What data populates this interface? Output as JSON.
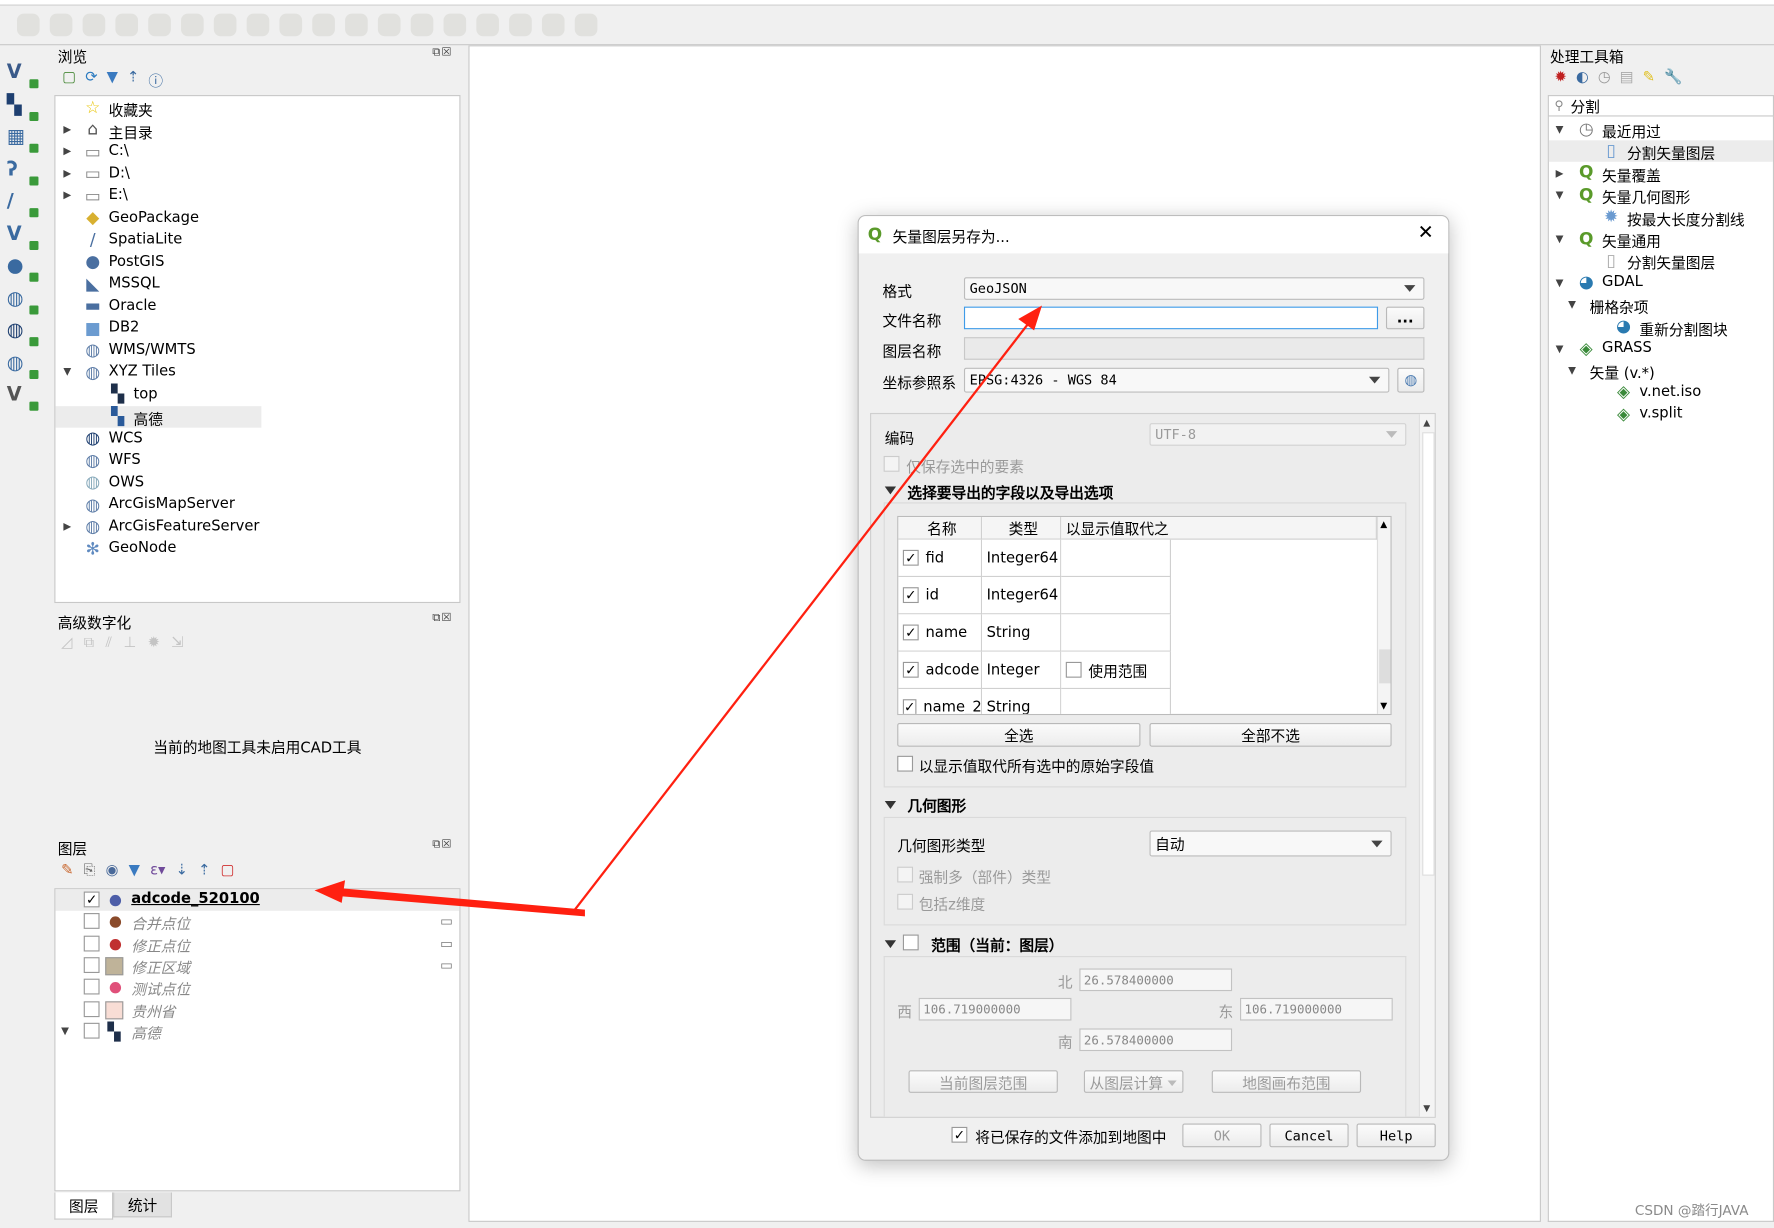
{
  "toolbar": {
    "icons": [
      "digitize-icon",
      "points-icon",
      "polygon-ring-icon",
      "polygon-fill-icon",
      "add-ring-icon",
      "add-part-icon",
      "fill-ring-icon",
      "delete-ring-icon",
      "delete-part-icon",
      "reshape-icon",
      "offset-icon",
      "vertex-icon",
      "split-icon",
      "split-features-icon",
      "split-parts-icon",
      "merge-icon",
      "merge-attr-icon",
      "rotate-icon"
    ]
  },
  "left_toolbar": {
    "icons": [
      "add-vector-layer-icon",
      "add-raster-layer-icon",
      "add-mesh-layer-icon",
      "add-delimited-text-icon",
      "add-spatialite-icon",
      "add-virtual-layer-icon",
      "add-postgis-icon",
      "add-wms-icon",
      "add-wcs-icon",
      "add-wfs-icon",
      "new-layer-icon"
    ]
  },
  "browser": {
    "title": "浏览",
    "items": [
      {
        "label": "收藏夹",
        "icon": "star-icon",
        "glyph": "☆",
        "color": "#e8c400",
        "expand": "",
        "depth": 0
      },
      {
        "label": "主目录",
        "icon": "home-folder-icon",
        "glyph": "⌂",
        "color": "#555",
        "expand": "▶",
        "depth": 0
      },
      {
        "label": "C:\\",
        "icon": "folder-icon",
        "glyph": "▭",
        "color": "#888",
        "expand": "▶",
        "depth": 0
      },
      {
        "label": "D:\\",
        "icon": "folder-icon",
        "glyph": "▭",
        "color": "#888",
        "expand": "▶",
        "depth": 0
      },
      {
        "label": "E:\\",
        "icon": "folder-icon",
        "glyph": "▭",
        "color": "#888",
        "expand": "▶",
        "depth": 0
      },
      {
        "label": "GeoPackage",
        "icon": "geopackage-icon",
        "glyph": "◆",
        "color": "#d8b030",
        "expand": "",
        "depth": 0
      },
      {
        "label": "SpatiaLite",
        "icon": "feather-icon",
        "glyph": "/",
        "color": "#4a6fa0",
        "expand": "",
        "depth": 0
      },
      {
        "label": "PostGIS",
        "icon": "elephant-icon",
        "glyph": "●",
        "color": "#4a6fa0",
        "expand": "",
        "depth": 0
      },
      {
        "label": "MSSQL",
        "icon": "mssql-icon",
        "glyph": "◣",
        "color": "#4a6fa0",
        "expand": "",
        "depth": 0
      },
      {
        "label": "Oracle",
        "icon": "oracle-icon",
        "glyph": "▬",
        "color": "#4a6fa0",
        "expand": "",
        "depth": 0
      },
      {
        "label": "DB2",
        "icon": "db2-icon",
        "glyph": "■",
        "color": "#6b9bd0",
        "expand": "",
        "depth": 0
      },
      {
        "label": "WMS/WMTS",
        "icon": "globe-icon",
        "glyph": "◍",
        "color": "#5f7ea8",
        "expand": "",
        "depth": 0
      },
      {
        "label": "XYZ Tiles",
        "icon": "globe-icon",
        "glyph": "◍",
        "color": "#5f7ea8",
        "expand": "▼",
        "depth": 0
      },
      {
        "label": "top",
        "icon": "tile-icon",
        "glyph": "▚",
        "color": "#1e2f4a",
        "expand": "",
        "depth": 1
      },
      {
        "label": "高德",
        "icon": "tile-icon",
        "glyph": "▚",
        "color": "#2a5a9a",
        "expand": "",
        "depth": 1,
        "selected": true
      },
      {
        "label": "WCS",
        "icon": "globe-icon",
        "glyph": "◍",
        "color": "#1e3f70",
        "expand": "",
        "depth": 0
      },
      {
        "label": "WFS",
        "icon": "globe-icon",
        "glyph": "◍",
        "color": "#5f7ea8",
        "expand": "",
        "depth": 0
      },
      {
        "label": "OWS",
        "icon": "globe-icon",
        "glyph": "◍",
        "color": "#8ab",
        "expand": "",
        "depth": 0
      },
      {
        "label": "ArcGisMapServer",
        "icon": "globe-icon",
        "glyph": "◍",
        "color": "#5f7ea8",
        "expand": "",
        "depth": 0
      },
      {
        "label": "ArcGisFeatureServer",
        "icon": "globe-icon",
        "glyph": "◍",
        "color": "#5f7ea8",
        "expand": "▶",
        "depth": 0
      },
      {
        "label": "GeoNode",
        "icon": "geonode-icon",
        "glyph": "✻",
        "color": "#5f8ac0",
        "expand": "",
        "depth": 0
      }
    ]
  },
  "advanced_digitizing": {
    "title": "高级数字化",
    "message": "当前的地图工具未启用CAD工具"
  },
  "layers": {
    "title": "图层",
    "items": [
      {
        "label": "adcode_520100",
        "checked": true,
        "symbol": "circle",
        "color": "#4d5ea8",
        "active": true,
        "expand": ""
      },
      {
        "label": "合并点位",
        "checked": false,
        "symbol": "circle",
        "color": "#8a4a2a",
        "memory": true,
        "expand": ""
      },
      {
        "label": "修正点位",
        "checked": false,
        "symbol": "circle",
        "color": "#c03030",
        "memory": true,
        "expand": ""
      },
      {
        "label": "修正区域",
        "checked": false,
        "symbol": "square",
        "color": "#bfb399",
        "memory": true,
        "expand": ""
      },
      {
        "label": "测试点位",
        "checked": false,
        "symbol": "circle",
        "color": "#e0507a",
        "expand": ""
      },
      {
        "label": "贵州省",
        "checked": false,
        "symbol": "square",
        "color": "#f8ddd5",
        "expand": ""
      },
      {
        "label": "高德",
        "checked": false,
        "symbol": "tile",
        "color": "#1e2f4a",
        "expand": "▼"
      }
    ],
    "tabs": [
      "图层",
      "统计"
    ]
  },
  "processing": {
    "title": "处理工具箱",
    "search": "分割",
    "items": [
      {
        "label": "最近用过",
        "depth": 0,
        "expand": "▼",
        "icon": "clock-icon",
        "glyph": "◷",
        "color": "#777"
      },
      {
        "label": "分割矢量图层",
        "depth": 1,
        "expand": "",
        "icon": "split-layer-icon",
        "glyph": "▯",
        "color": "#6a9ad0",
        "selected": true
      },
      {
        "label": "矢量覆盖",
        "depth": 0,
        "expand": "▶",
        "icon": "qgis-icon",
        "glyph": "Q",
        "color": "#5a9a2a"
      },
      {
        "label": "矢量几何图形",
        "depth": 0,
        "expand": "▼",
        "icon": "qgis-icon",
        "glyph": "Q",
        "color": "#5a9a2a"
      },
      {
        "label": "按最大长度分割线",
        "depth": 1,
        "expand": "",
        "icon": "gear-icon",
        "glyph": "✹",
        "color": "#6a9ad0"
      },
      {
        "label": "矢量通用",
        "depth": 0,
        "expand": "▼",
        "icon": "qgis-icon",
        "glyph": "Q",
        "color": "#5a9a2a"
      },
      {
        "label": "分割矢量图层",
        "depth": 1,
        "expand": "",
        "icon": "split-layer-icon",
        "glyph": "▯",
        "color": "#aaa"
      },
      {
        "label": "GDAL",
        "depth": 0,
        "expand": "▼",
        "icon": "gdal-icon",
        "glyph": "◕",
        "color": "#2a7ab0"
      },
      {
        "label": "栅格杂项",
        "depth": 0.5,
        "expand": "▼",
        "icon": "",
        "glyph": "",
        "color": ""
      },
      {
        "label": "重新分割图块",
        "depth": 1.5,
        "expand": "",
        "icon": "gdal-icon",
        "glyph": "◕",
        "color": "#2a7ab0"
      },
      {
        "label": "GRASS",
        "depth": 0,
        "expand": "▼",
        "icon": "grass-icon",
        "glyph": "◈",
        "color": "#3a8a3a"
      },
      {
        "label": "矢量 (v.*)",
        "depth": 0.5,
        "expand": "▼",
        "icon": "",
        "glyph": "",
        "color": ""
      },
      {
        "label": "v.net.iso",
        "depth": 1.5,
        "expand": "",
        "icon": "grass-icon",
        "glyph": "◈",
        "color": "#3a8a3a"
      },
      {
        "label": "v.split",
        "depth": 1.5,
        "expand": "",
        "icon": "grass-icon",
        "glyph": "◈",
        "color": "#3a8a3a"
      }
    ]
  },
  "dialog": {
    "title": "矢量图层另存为...",
    "format_label": "格式",
    "format_value": "GeoJSON",
    "filename_label": "文件名称",
    "filename_value": "",
    "browse_label": "...",
    "layername_label": "图层名称",
    "layername_value": "",
    "crs_label": "坐标参照系",
    "crs_value": "EPSG:4326 - WGS 84",
    "encoding_label": "编码",
    "encoding_value": "UTF-8",
    "selected_only_label": "仅保存选中的要素",
    "fields_header": "选择要导出的字段以及导出选项",
    "fields_columns": [
      "名称",
      "类型",
      "以显示值取代之"
    ],
    "fields": [
      {
        "name": "fid",
        "type": "Integer64",
        "checked": true,
        "replace": ""
      },
      {
        "name": "id",
        "type": "Integer64",
        "checked": true,
        "replace": ""
      },
      {
        "name": "name",
        "type": "String",
        "checked": true,
        "replace": ""
      },
      {
        "name": "adcode",
        "type": "Integer",
        "checked": true,
        "replace": "使用范围"
      },
      {
        "name": "name_2",
        "type": "String",
        "checked": true,
        "replace": ""
      }
    ],
    "select_all": "全选",
    "deselect_all": "全部不选",
    "replace_all_label": "以显示值取代所有选中的原始字段值",
    "geometry_header": "几何图形",
    "geometry_type_label": "几何图形类型",
    "geometry_type_value": "自动",
    "force_multi_label": "强制多（部件）类型",
    "include_z_label": "包括z维度",
    "extent_header": "范围（当前：图层）",
    "north_label": "北",
    "north": "26.578400000",
    "west_label": "西",
    "west": "106.719000000",
    "east_label": "东",
    "east": "106.719000000",
    "south_label": "南",
    "south": "26.578400000",
    "current_layer_extent": "当前图层范围",
    "calc_from_layer": "从图层计算",
    "map_canvas_extent": "地图画布范围",
    "add_to_map_label": "将已保存的文件添加到地图中",
    "ok": "OK",
    "cancel": "Cancel",
    "help": "Help"
  },
  "annotation_color": "#ff2010",
  "watermark": "CSDN @踏行JAVA"
}
